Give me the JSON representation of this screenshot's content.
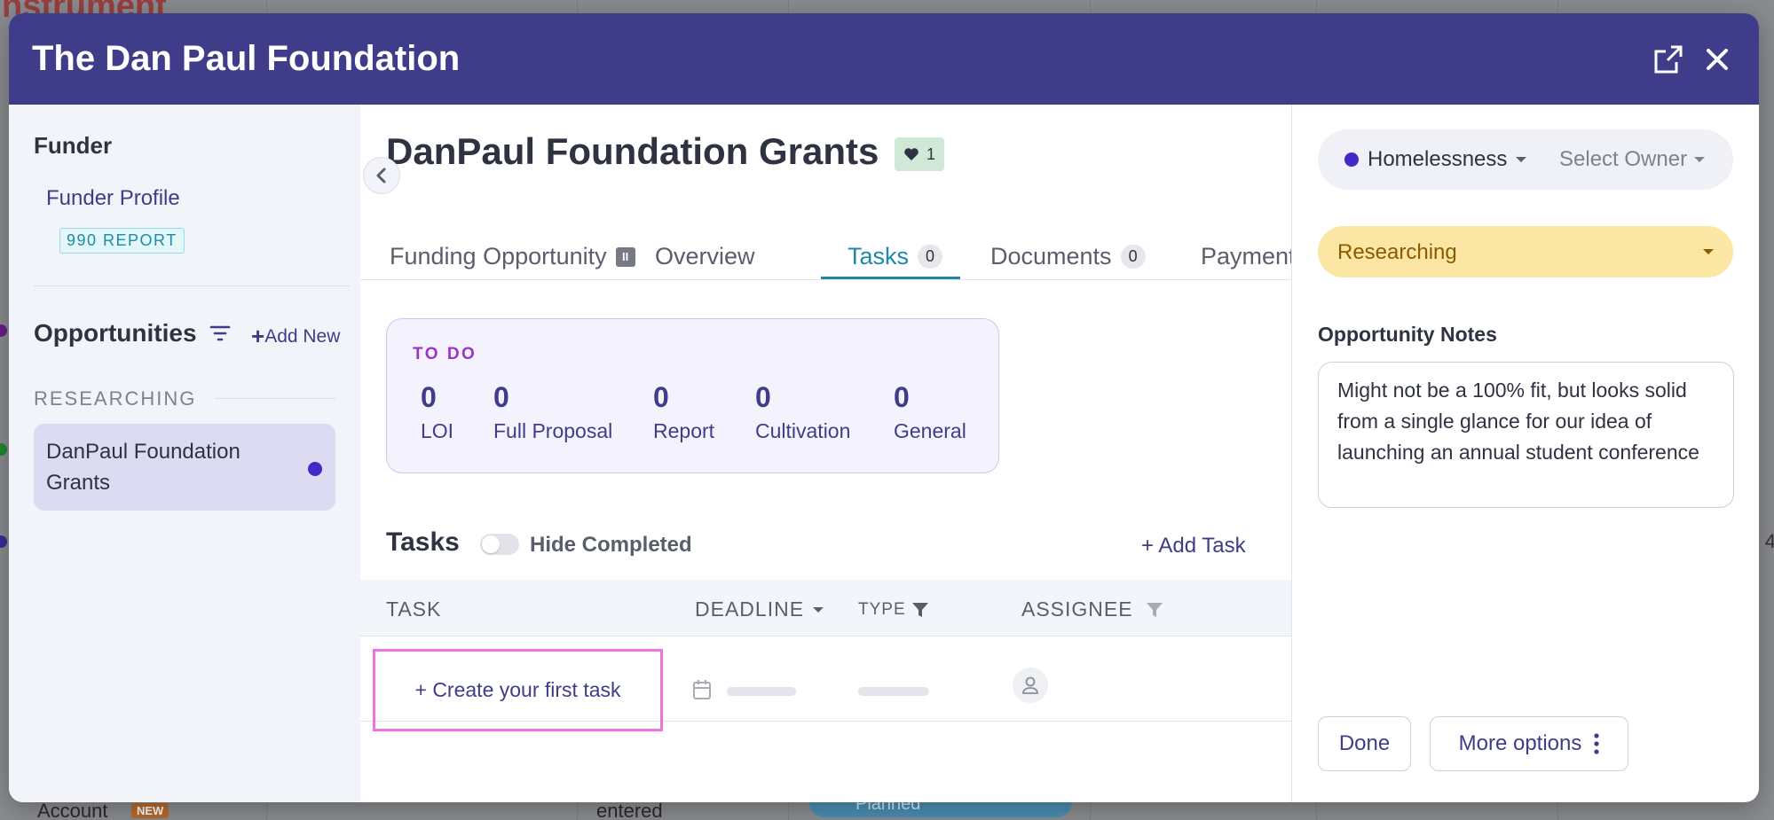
{
  "background": {
    "title_fragment": "nstrument",
    "account_label": "Account",
    "new_badge": "NEW",
    "entered_text": "entered",
    "planned_text": "Planned",
    "right_digit": "4"
  },
  "modal": {
    "title": "The Dan Paul Foundation",
    "open_external_icon": "external-link-icon",
    "close_icon": "close-icon",
    "header_color": "#3f3c89"
  },
  "sidebar": {
    "funder_heading": "Funder",
    "funder_profile_link": "Funder Profile",
    "report_badge": "990 REPORT",
    "opportunities_heading": "Opportunities",
    "add_new_label": "Add New",
    "researching_group": "RESEARCHING",
    "opportunity_item": "DanPaul Foundation Grants"
  },
  "main": {
    "title": "DanPaul Foundation Grants",
    "like_count": "1",
    "tabs": [
      {
        "label": "Funding Opportunity"
      },
      {
        "label": "Overview"
      },
      {
        "label": "Tasks",
        "count": "0",
        "active": true
      },
      {
        "label": "Documents",
        "count": "0"
      },
      {
        "label": "Payment"
      }
    ],
    "todo": {
      "heading": "TO DO",
      "stats": [
        {
          "num": "0",
          "label": "LOI"
        },
        {
          "num": "0",
          "label": "Full Proposal"
        },
        {
          "num": "0",
          "label": "Report"
        },
        {
          "num": "0",
          "label": "Cultivation"
        },
        {
          "num": "0",
          "label": "General"
        }
      ]
    },
    "tasks_heading": "Tasks",
    "hide_completed": "Hide Completed",
    "add_task": "+ Add Task",
    "columns": {
      "task": "TASK",
      "deadline": "DEADLINE",
      "type": "TYPE",
      "assignee": "ASSIGNEE"
    },
    "create_first_task": "+ Create your first task"
  },
  "right": {
    "cause_area": "Homelessness",
    "owner_placeholder": "Select Owner",
    "status": "Researching",
    "notes_label": "Opportunity Notes",
    "notes_text": "Might not be a 100% fit, but looks solid from a single glance for our idea of launching an annual student conference",
    "done_button": "Done",
    "more_options_button": "More options"
  },
  "colors": {
    "accent": "#3f3c89",
    "tab_active": "#1e88a8",
    "status_bg": "#fce6a3",
    "todo_heading": "#9b34c4",
    "create_border": "#f071e0"
  }
}
